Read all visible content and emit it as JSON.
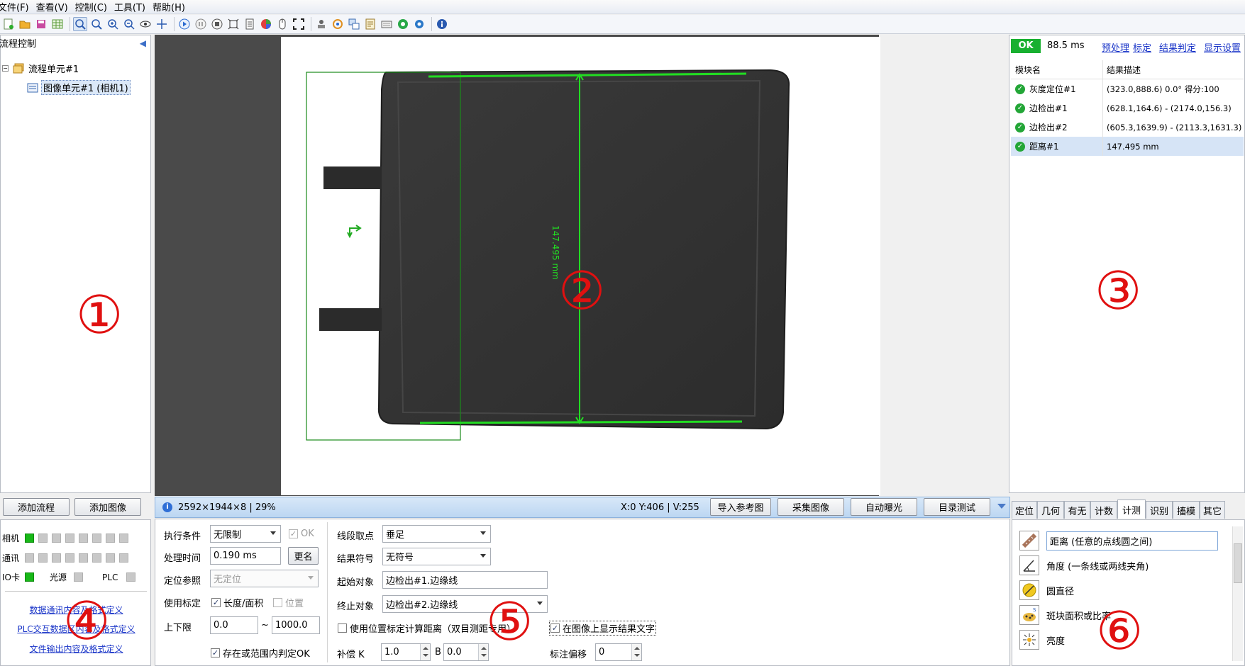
{
  "menu": [
    "文件(F)",
    "查看(V)",
    "控制(C)",
    "工具(T)",
    "帮助(H)"
  ],
  "left": {
    "title": "流程控制",
    "tree": [
      "流程单元#1",
      "图像单元#1 (相机1)"
    ],
    "add_flow": "添加流程",
    "add_image": "添加图像"
  },
  "io": {
    "camera": "相机",
    "comm": "通讯",
    "iocard": "IO卡",
    "light": "光源",
    "plc": "PLC",
    "links": [
      "数据通讯内容及格式定义",
      "PLC交互数据区内容及格式定义",
      "文件输出内容及格式定义"
    ]
  },
  "markers": {
    "m1": "①",
    "m2": "②",
    "m3": "③",
    "m4": "④",
    "m5": "⑤",
    "m6": "⑥"
  },
  "image": {
    "measure_label": "147.495 mm"
  },
  "status": {
    "info": "2592×1944×8 | 29%",
    "coords": "X:0 Y:406 | V:255",
    "buttons": [
      "导入参考图",
      "采集图像",
      "自动曝光",
      "目录测试"
    ]
  },
  "params": {
    "exec_cond_label": "执行条件",
    "exec_cond": "无限制",
    "ok_label": "OK",
    "proc_time_label": "处理时间",
    "proc_time": "0.190 ms",
    "rename": "更名",
    "loc_ref_label": "定位参照",
    "loc_ref": "无定位",
    "use_cal_label": "使用标定",
    "len_area": "长度/面积",
    "position": "位置",
    "limit_label": "上下限",
    "low": "0.0",
    "tilde": "~",
    "high": "1000.0",
    "judge_ok": "存在或范围内判定OK",
    "seg_pick_label": "线段取点",
    "seg_pick": "垂足",
    "result_sym_label": "结果符号",
    "result_sym": "无符号",
    "start_obj_label": "起始对象",
    "start_obj": "边检出#1.边缘线",
    "end_obj_label": "终止对象",
    "end_obj": "边检出#2.边缘线",
    "use_pos_cal": "使用位置标定计算距离（双目测距专用）",
    "show_text": "在图像上显示结果文字",
    "comp_k_label": "补偿 K",
    "k": "1.0",
    "b_label": "B",
    "b": "0.0",
    "offset_label": "标注偏移",
    "offset": "0"
  },
  "right": {
    "ok": "OK",
    "time": "88.5 ms",
    "links": [
      "预处理",
      "标定",
      "结果判定",
      "显示设置"
    ],
    "col_module": "模块名",
    "col_result": "结果描述",
    "rows": [
      {
        "name": "灰度定位#1",
        "result": "(323.0,888.6) 0.0° 得分:100"
      },
      {
        "name": "边检出#1",
        "result": "(628.1,164.6) - (2174.0,156.3)"
      },
      {
        "name": "边检出#2",
        "result": "(605.3,1639.9) - (2113.3,1631.3)"
      },
      {
        "name": "距离#1",
        "result": "147.495 mm"
      }
    ]
  },
  "tabs": [
    "定位",
    "几何",
    "有无",
    "计数",
    "计测",
    "识别",
    "搐模",
    "其它"
  ],
  "tools": [
    {
      "icon": "ruler-icon",
      "label": "距离 (任意的点线圆之间)"
    },
    {
      "icon": "angle-icon",
      "label": "角度 (一条线或两线夹角)"
    },
    {
      "icon": "circle-diameter-icon",
      "label": "圆直径"
    },
    {
      "icon": "blob-icon",
      "label": "斑块面积或比率"
    },
    {
      "icon": "brightness-icon",
      "label": "亮度"
    }
  ],
  "colors": {
    "ok_green": "#18b030",
    "measure_green": "#22dd22",
    "marker_red": "#e01010",
    "link_blue": "#1a35c8"
  }
}
